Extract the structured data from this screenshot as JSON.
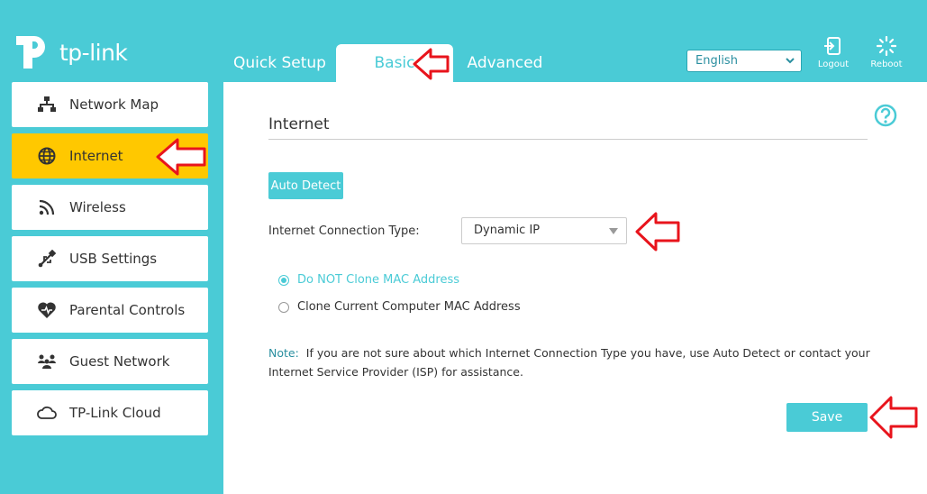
{
  "brand": {
    "logo_text": "tp-link"
  },
  "topnav": {
    "tabs": [
      {
        "label": "Quick Setup",
        "active": false
      },
      {
        "label": "Basic",
        "active": true
      },
      {
        "label": "Advanced",
        "active": false
      }
    ]
  },
  "header": {
    "language": "English",
    "logout_label": "Logout",
    "reboot_label": "Reboot"
  },
  "sidebar": {
    "items": [
      {
        "label": "Network Map",
        "icon": "network-map-icon",
        "active": false
      },
      {
        "label": "Internet",
        "icon": "globe-icon",
        "active": true
      },
      {
        "label": "Wireless",
        "icon": "wifi-icon",
        "active": false
      },
      {
        "label": "USB Settings",
        "icon": "usb-icon",
        "active": false
      },
      {
        "label": "Parental Controls",
        "icon": "heart-icon",
        "active": false
      },
      {
        "label": "Guest Network",
        "icon": "guest-icon",
        "active": false
      },
      {
        "label": "TP-Link Cloud",
        "icon": "cloud-icon",
        "active": false
      }
    ]
  },
  "main": {
    "title": "Internet",
    "auto_detect_label": "Auto Detect",
    "connection_type_label": "Internet Connection Type:",
    "connection_type_value": "Dynamic IP",
    "mac_options": [
      {
        "label": "Do NOT Clone MAC Address",
        "checked": true
      },
      {
        "label": "Clone Current Computer MAC Address",
        "checked": false
      }
    ],
    "note_label": "Note:",
    "note_text": "If you are not sure about which Internet Connection Type you have, use Auto Detect or contact your Internet Service Provider (ISP) for assistance.",
    "save_label": "Save"
  },
  "colors": {
    "accent": "#4acbd6",
    "active_item": "#ffc800",
    "annotation": "#e8141c"
  }
}
